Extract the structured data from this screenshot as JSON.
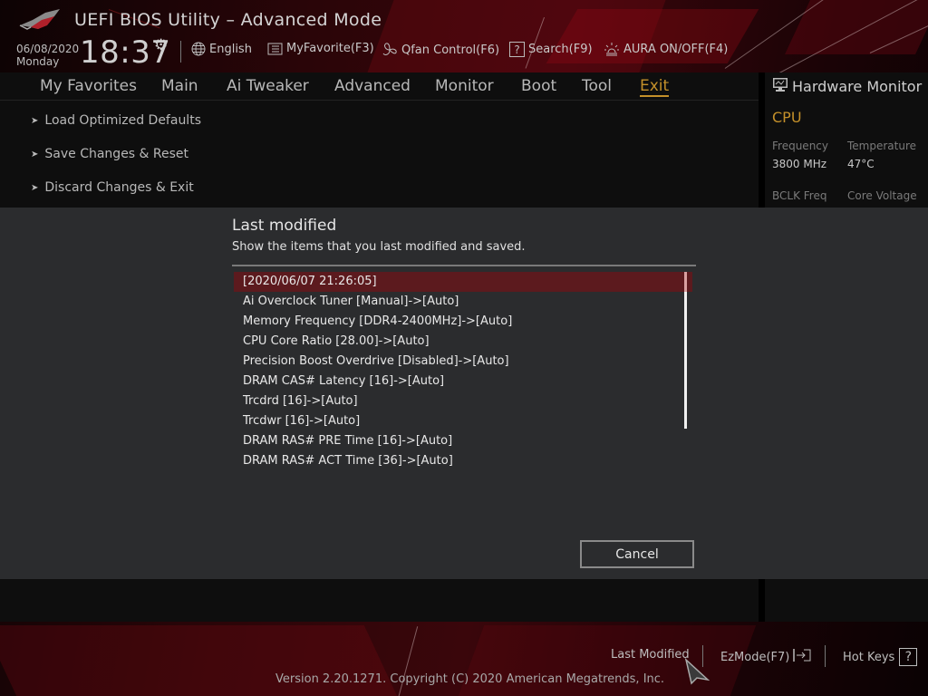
{
  "header": {
    "title": "UEFI BIOS Utility – Advanced Mode",
    "date": "06/08/2020",
    "weekday": "Monday",
    "time": "18:37",
    "toolbar": [
      {
        "icon": "globe-icon",
        "label": "English"
      },
      {
        "icon": "favorite-list-icon",
        "label": "MyFavorite(F3)"
      },
      {
        "icon": "fan-icon",
        "label": "Qfan Control(F6)"
      },
      {
        "icon": "search-help-icon",
        "label": "Search(F9)"
      },
      {
        "icon": "aura-light-icon",
        "label": "AURA ON/OFF(F4)"
      }
    ]
  },
  "tabs": [
    {
      "label": "My Favorites",
      "active": false
    },
    {
      "label": "Main",
      "active": false
    },
    {
      "label": "Ai Tweaker",
      "active": false
    },
    {
      "label": "Advanced",
      "active": false
    },
    {
      "label": "Monitor",
      "active": false
    },
    {
      "label": "Boot",
      "active": false
    },
    {
      "label": "Tool",
      "active": false
    },
    {
      "label": "Exit",
      "active": true
    }
  ],
  "exit_menu": [
    {
      "label": "Load Optimized Defaults"
    },
    {
      "label": "Save Changes & Reset"
    },
    {
      "label": "Discard Changes & Exit"
    }
  ],
  "hardware_monitor": {
    "title": "Hardware Monitor",
    "section": "CPU",
    "frequency_label": "Frequency",
    "frequency_value": "3800 MHz",
    "temperature_label": "Temperature",
    "temperature_value": "47°C",
    "bclk_label": "BCLK Freq",
    "voltage_label": "Core Voltage"
  },
  "dialog": {
    "title": "Last modified",
    "description": "Show the items that you last modified and saved.",
    "items": [
      "[2020/06/07 21:26:05]",
      "Ai Overclock Tuner [Manual]->[Auto]",
      "Memory Frequency [DDR4-2400MHz]->[Auto]",
      "CPU Core Ratio [28.00]->[Auto]",
      "Precision Boost Overdrive [Disabled]->[Auto]",
      "DRAM CAS# Latency [16]->[Auto]",
      "Trcdrd [16]->[Auto]",
      "Trcdwr [16]->[Auto]",
      "DRAM RAS# PRE Time [16]->[Auto]",
      "DRAM RAS# ACT Time [36]->[Auto]"
    ],
    "selected_index": 0,
    "cancel_label": "Cancel"
  },
  "footer": {
    "last_modified": "Last Modified",
    "ezmode": "EzMode(F7)",
    "hotkeys": "Hot Keys",
    "copyright": "Version 2.20.1271. Copyright (C) 2020 American Megatrends, Inc."
  },
  "colors": {
    "accent": "#c4902a",
    "selection": "#5c1a1e",
    "dialog_bg": "#2b2c2e",
    "panel_bg": "#0e0e0e"
  }
}
